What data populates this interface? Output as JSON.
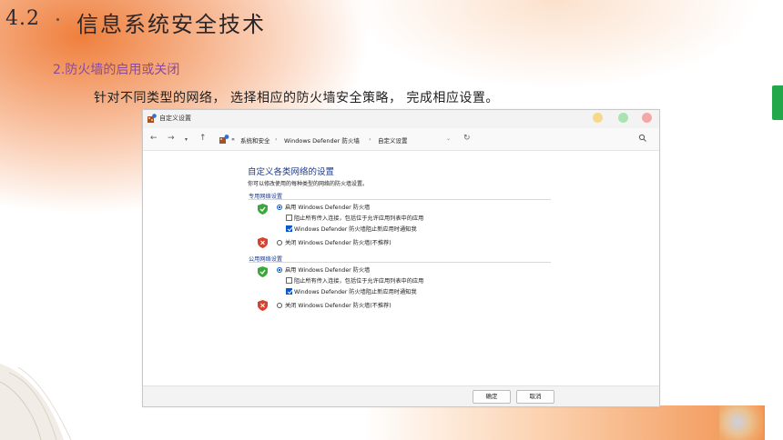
{
  "slide": {
    "number": "4.2",
    "title": "信息系统安全技术",
    "subheading": "2.防火墙的启用或关闭",
    "body": "针对不同类型的网络， 选择相应的防火墙安全策略， 完成相应设置。"
  },
  "window": {
    "title": "自定义设置",
    "breadcrumb": {
      "prefix": "«",
      "items": [
        "系统和安全",
        "Windows Defender 防火墙",
        "自定义设置"
      ],
      "separator": "›"
    },
    "content": {
      "heading": "自定义各类网络的设置",
      "description": "你可以修改使用的每种类型的网络的防火墙设置。",
      "sections": [
        {
          "label": "专用网络设置",
          "enable_label": "启用 Windows Defender 防火墙",
          "enable_selected": true,
          "block_all_label": "阻止所有传入连接，包括位于允许应用列表中的应用",
          "block_all_checked": false,
          "notify_label": "Windows Defender 防火墙阻止新应用时通知我",
          "notify_checked": true,
          "disable_label": "关闭 Windows Defender 防火墙(不推荐)",
          "disable_selected": false
        },
        {
          "label": "公用网络设置",
          "enable_label": "启用 Windows Defender 防火墙",
          "enable_selected": true,
          "block_all_label": "阻止所有传入连接，包括位于允许应用列表中的应用",
          "block_all_checked": false,
          "notify_label": "Windows Defender 防火墙阻止新应用时通知我",
          "notify_checked": true,
          "disable_label": "关闭 Windows Defender 防火墙(不推荐)",
          "disable_selected": false
        }
      ]
    },
    "buttons": {
      "ok": "确定",
      "cancel": "取消"
    }
  },
  "colors": {
    "accent_orange": "#ee7832",
    "heading_blue": "#1d3a8a",
    "subheading_purple": "#8a4a9c",
    "check_blue": "#0b57d0",
    "shield_green": "#3aa83a",
    "shield_red": "#d9412f",
    "side_tab_green": "#22a84a"
  },
  "icons": [
    "firewall-app-icon",
    "back-arrow-icon",
    "forward-arrow-icon",
    "up-arrow-icon",
    "refresh-icon",
    "search-icon",
    "shield-check-icon",
    "shield-x-icon"
  ]
}
